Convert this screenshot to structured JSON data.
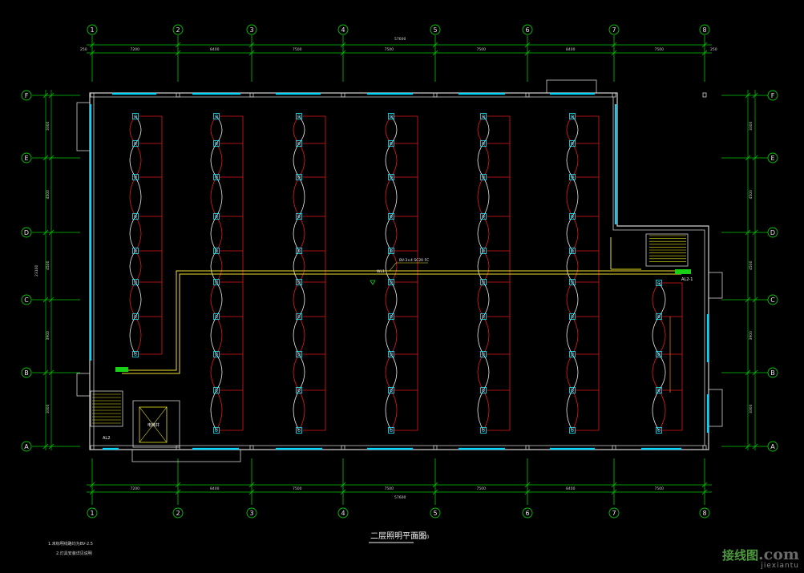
{
  "drawing": {
    "title": "二层照明平面图",
    "scale": "1:100",
    "notes": [
      "1.未标明线路均为BV-2.5",
      "2.灯具安装详见说明"
    ]
  },
  "axes": {
    "columns": [
      "1",
      "2",
      "3",
      "4",
      "5",
      "6",
      "7",
      "8"
    ],
    "rows": [
      "F",
      "E",
      "D",
      "C",
      "B",
      "A"
    ]
  },
  "dimensions": {
    "top_total": "57600",
    "bottom_total": "57600",
    "segments": [
      "7200",
      "8400",
      "7500",
      "7500",
      "7500",
      "8400",
      "7500"
    ],
    "edge": "250",
    "left_total": "23100",
    "left_segments": [
      "3300",
      "4500",
      "4500",
      "3900",
      "3300"
    ]
  },
  "labels": {
    "panel_main": "AL2",
    "panel_sub": "AL2-1",
    "feeder": "BV-3×4 SC20 FC",
    "elevator": "电梯井",
    "feeder_tag": "WL1"
  },
  "watermark": {
    "cn": "接线图",
    "com": ".com",
    "pinyin": "jiexiantu"
  },
  "colors": {
    "background": "#000000",
    "grid": "#00c800",
    "wall": "#d0d0d0",
    "window": "#00d8ff",
    "circuit": "#e11a1a",
    "arc": "#e8e8e8",
    "feeder": "#f0e030",
    "fixture": "#20e8ff",
    "panel": "#18d018"
  }
}
